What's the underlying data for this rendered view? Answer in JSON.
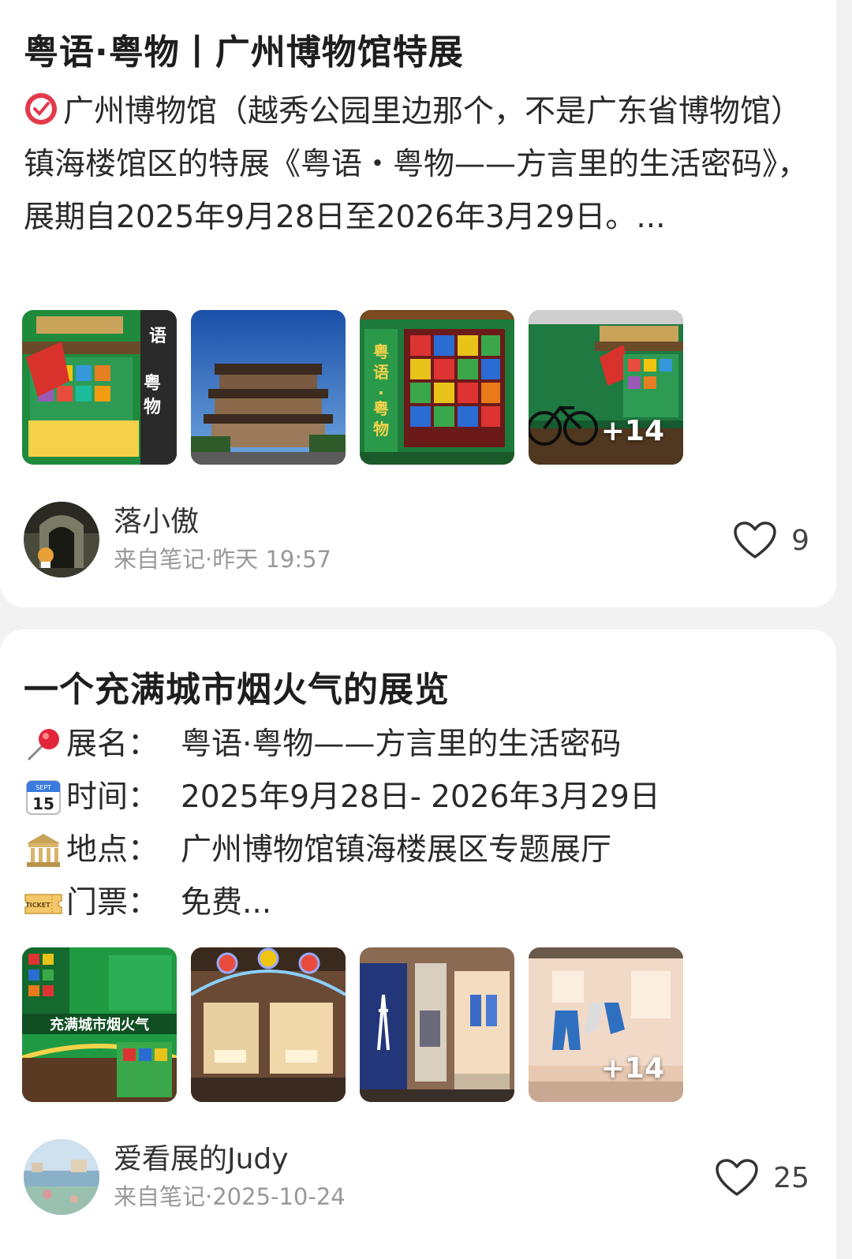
{
  "posts": [
    {
      "title": "粤语·粤物丨广州博物馆特展",
      "pin_icon": "round-pushpin-icon",
      "body": "广州博物馆（越秀公园里边那个，不是广东省博物馆）镇海楼馆区的特展《粤语・粤物——方言里的生活密码》，展期自2025年9月28日至2026年3月29日。...",
      "thumbnails": [
        {
          "icon": "exhibit-storefront-photo",
          "overlay_text": "粤语·粤物"
        },
        {
          "icon": "zhenhai-tower-photo"
        },
        {
          "icon": "stained-glass-window-photo",
          "overlay_text": "粤语·粤物"
        },
        {
          "icon": "exhibit-bicycle-stall-photo",
          "more_label": "+14"
        }
      ],
      "author": {
        "name": "落小傲",
        "meta": "来自笔记·昨天 19:57"
      },
      "likes": "9"
    },
    {
      "title": "一个充满城市烟火气的展览",
      "lines": [
        {
          "icon": "round-pushpin-icon",
          "label": "展名：",
          "value": "粤语·粤物——方言里的生活密码"
        },
        {
          "icon": "calendar-icon",
          "label": "时间：",
          "value": "2025年9月28日- 2026年3月29日"
        },
        {
          "icon": "classical-building-icon",
          "label": "地点：",
          "value": "广州博物馆镇海楼展区专题展厅"
        },
        {
          "icon": "ticket-icon",
          "label": "门票：",
          "value": "免费..."
        }
      ],
      "thumbnails": [
        {
          "icon": "green-exhibit-entrance-photo",
          "overlay_text": "充满城市烟火气"
        },
        {
          "icon": "lantern-arch-hall-photo"
        },
        {
          "icon": "clothing-display-photo"
        },
        {
          "icon": "jeans-display-case-photo",
          "more_label": "+14"
        }
      ],
      "author": {
        "name": "爱看展的Judy",
        "meta": "来自笔记·2025-10-24"
      },
      "likes": "25"
    }
  ],
  "colors": {
    "background": "#f2f2f2",
    "card": "#ffffff",
    "title": "#1e1e1e",
    "meta": "#999999"
  }
}
